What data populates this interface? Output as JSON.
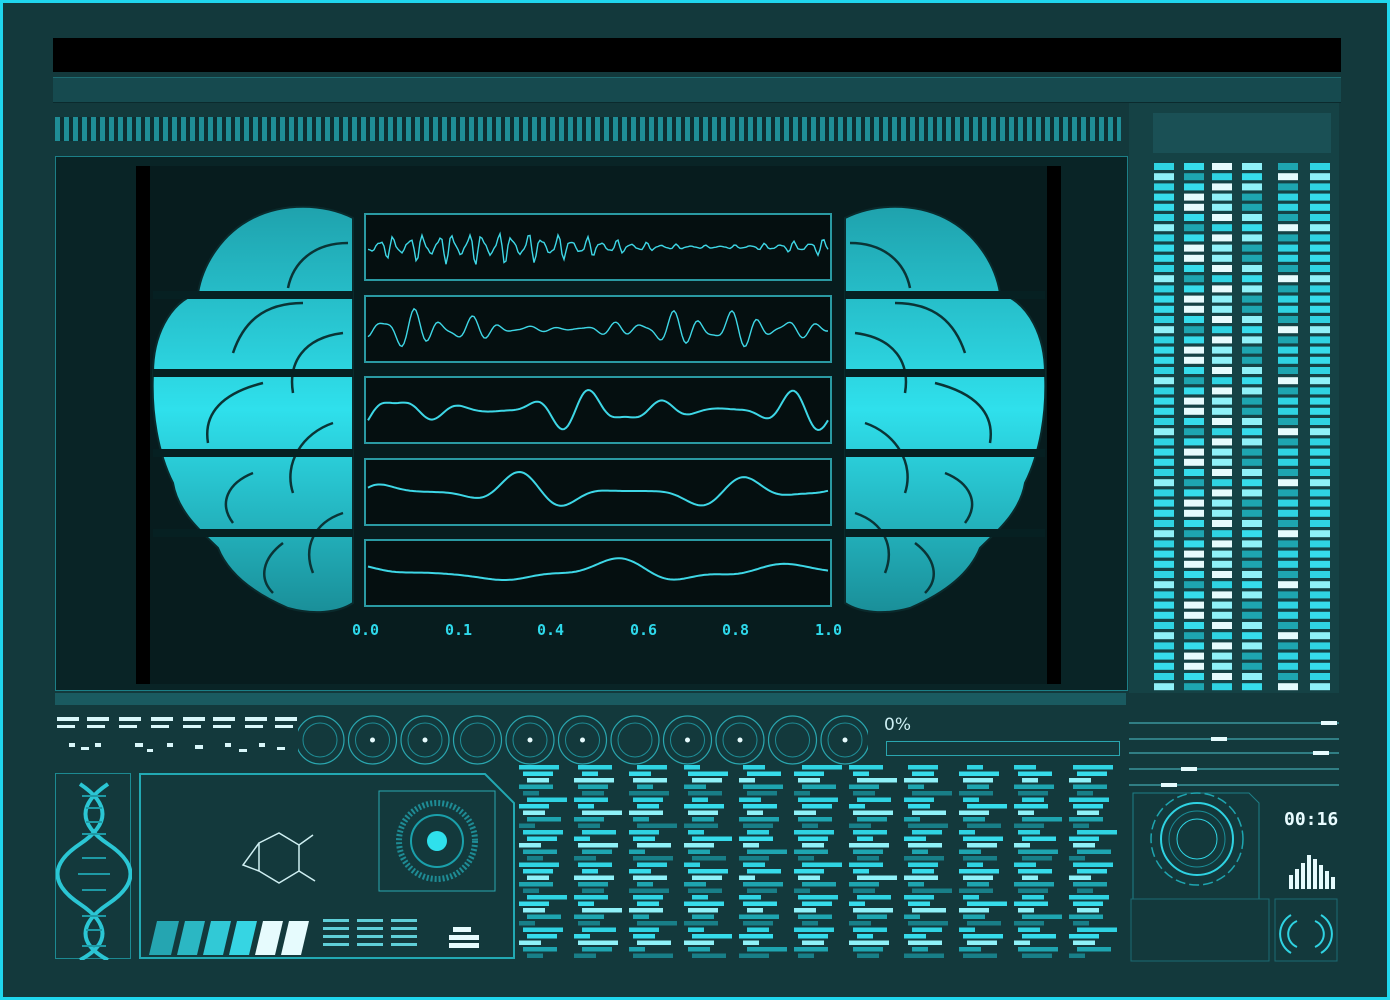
{
  "colors": {
    "frame": "#1fd6ee",
    "accent": "#2ed8ea",
    "panel": "#13393c",
    "wave": "#3ed7e6",
    "brain": "#26c8d6"
  },
  "waveform_chart": {
    "type": "line",
    "x_ticks": [
      "0.0",
      "0.1",
      "0.4",
      "0.6",
      "0.8",
      "1.0"
    ],
    "series_count": 5
  },
  "progress": {
    "label": "0%",
    "value": 0
  },
  "timer": {
    "text": "00:16"
  },
  "icons": [
    "brain-left-icon",
    "brain-right-icon",
    "dna-helix-icon",
    "molecule-icon",
    "radar-disc-icon",
    "ring-target-icon",
    "signal-icon",
    "equalizer-icon"
  ]
}
